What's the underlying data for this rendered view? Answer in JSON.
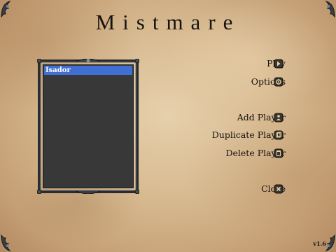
{
  "title": "Mistmare",
  "players": [
    {
      "name": "Isador",
      "selected": true
    }
  ],
  "menu": {
    "play": {
      "label": "Play",
      "icon": "arrow-right-icon"
    },
    "options": {
      "label": "Options",
      "icon": "gear-icon"
    },
    "add_player": {
      "label": "Add Player",
      "icon": "add-player-icon"
    },
    "duplicate_player": {
      "label": "Duplicate Player",
      "icon": "duplicate-player-icon"
    },
    "delete_player": {
      "label": "Delete Player",
      "icon": "delete-player-icon"
    },
    "close": {
      "label": "Close",
      "icon": "close-icon"
    }
  },
  "version": "v1.6",
  "colors": {
    "parchment": "#d7b98f",
    "list_background": "#383838",
    "selection": "#3f6fd3",
    "text": "#141210"
  }
}
